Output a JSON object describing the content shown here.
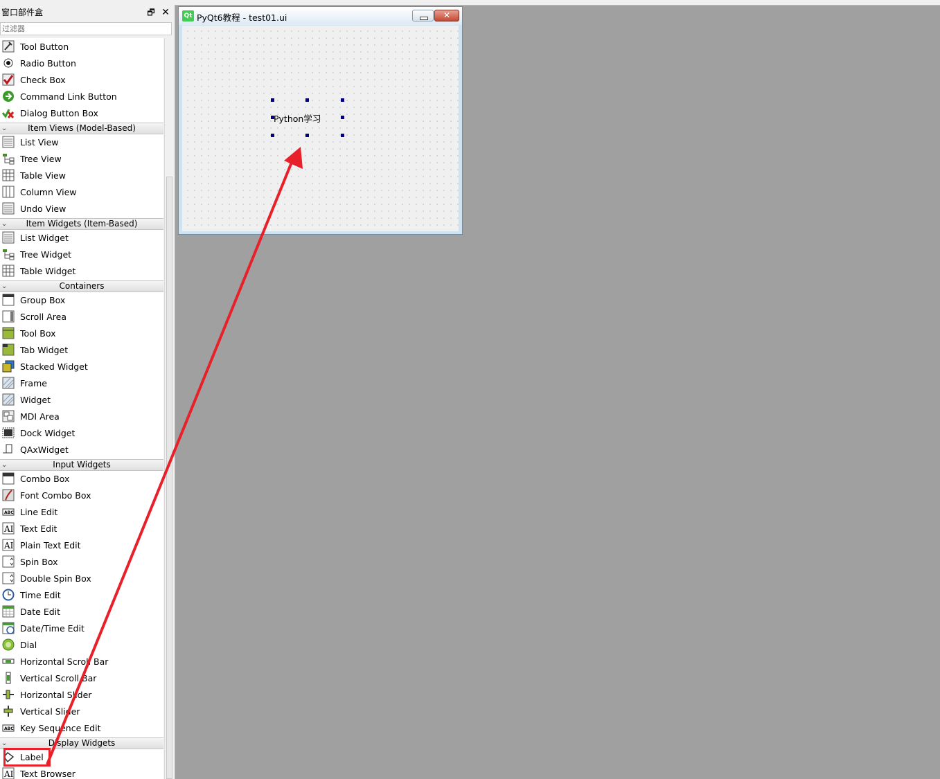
{
  "panel": {
    "title": "窗口部件盒",
    "float_glyph": "🗗",
    "close_glyph": "✕",
    "filter_placeholder": "过滤器"
  },
  "widget_list": [
    {
      "kind": "item",
      "label": "Tool Button",
      "icon": "tool-button-icon"
    },
    {
      "kind": "item",
      "label": "Radio Button",
      "icon": "radio-button-icon"
    },
    {
      "kind": "item",
      "label": "Check Box",
      "icon": "check-box-icon"
    },
    {
      "kind": "item",
      "label": "Command Link Button",
      "icon": "command-link-icon"
    },
    {
      "kind": "item",
      "label": "Dialog Button Box",
      "icon": "dialog-button-box-icon"
    },
    {
      "kind": "cat",
      "label": "Item Views (Model-Based)"
    },
    {
      "kind": "item",
      "label": "List View",
      "icon": "list-view-icon"
    },
    {
      "kind": "item",
      "label": "Tree View",
      "icon": "tree-view-icon"
    },
    {
      "kind": "item",
      "label": "Table View",
      "icon": "table-view-icon"
    },
    {
      "kind": "item",
      "label": "Column View",
      "icon": "column-view-icon"
    },
    {
      "kind": "item",
      "label": "Undo View",
      "icon": "undo-view-icon"
    },
    {
      "kind": "cat",
      "label": "Item Widgets (Item-Based)"
    },
    {
      "kind": "item",
      "label": "List Widget",
      "icon": "list-widget-icon"
    },
    {
      "kind": "item",
      "label": "Tree Widget",
      "icon": "tree-widget-icon"
    },
    {
      "kind": "item",
      "label": "Table Widget",
      "icon": "table-widget-icon"
    },
    {
      "kind": "cat",
      "label": "Containers"
    },
    {
      "kind": "item",
      "label": "Group Box",
      "icon": "group-box-icon"
    },
    {
      "kind": "item",
      "label": "Scroll Area",
      "icon": "scroll-area-icon"
    },
    {
      "kind": "item",
      "label": "Tool Box",
      "icon": "tool-box-icon"
    },
    {
      "kind": "item",
      "label": "Tab Widget",
      "icon": "tab-widget-icon"
    },
    {
      "kind": "item",
      "label": "Stacked Widget",
      "icon": "stacked-widget-icon"
    },
    {
      "kind": "item",
      "label": "Frame",
      "icon": "frame-icon"
    },
    {
      "kind": "item",
      "label": "Widget",
      "icon": "widget-icon"
    },
    {
      "kind": "item",
      "label": "MDI Area",
      "icon": "mdi-area-icon"
    },
    {
      "kind": "item",
      "label": "Dock Widget",
      "icon": "dock-widget-icon"
    },
    {
      "kind": "item",
      "label": "QAxWidget",
      "icon": "qaxwidget-icon"
    },
    {
      "kind": "cat",
      "label": "Input Widgets"
    },
    {
      "kind": "item",
      "label": "Combo Box",
      "icon": "combo-box-icon"
    },
    {
      "kind": "item",
      "label": "Font Combo Box",
      "icon": "font-combo-box-icon"
    },
    {
      "kind": "item",
      "label": "Line Edit",
      "icon": "line-edit-icon"
    },
    {
      "kind": "item",
      "label": "Text Edit",
      "icon": "text-edit-icon"
    },
    {
      "kind": "item",
      "label": "Plain Text Edit",
      "icon": "plain-text-edit-icon"
    },
    {
      "kind": "item",
      "label": "Spin Box",
      "icon": "spin-box-icon"
    },
    {
      "kind": "item",
      "label": "Double Spin Box",
      "icon": "double-spin-box-icon"
    },
    {
      "kind": "item",
      "label": "Time Edit",
      "icon": "time-edit-icon"
    },
    {
      "kind": "item",
      "label": "Date Edit",
      "icon": "date-edit-icon"
    },
    {
      "kind": "item",
      "label": "Date/Time Edit",
      "icon": "date-time-edit-icon"
    },
    {
      "kind": "item",
      "label": "Dial",
      "icon": "dial-icon"
    },
    {
      "kind": "item",
      "label": "Horizontal Scroll Bar",
      "icon": "horizontal-scroll-bar-icon"
    },
    {
      "kind": "item",
      "label": "Vertical Scroll Bar",
      "icon": "vertical-scroll-bar-icon"
    },
    {
      "kind": "item",
      "label": "Horizontal Slider",
      "icon": "horizontal-slider-icon"
    },
    {
      "kind": "item",
      "label": "Vertical Slider",
      "icon": "vertical-slider-icon"
    },
    {
      "kind": "item",
      "label": "Key Sequence Edit",
      "icon": "key-sequence-edit-icon"
    },
    {
      "kind": "cat",
      "label": "Display Widgets"
    },
    {
      "kind": "item",
      "label": "Label",
      "icon": "label-icon"
    },
    {
      "kind": "item",
      "label": "Text Browser",
      "icon": "text-browser-icon"
    }
  ],
  "form_window": {
    "logo_text": "Qt",
    "title": "PyQt6教程 - test01.ui",
    "close_glyph": "✕",
    "label_text": "Python学习"
  },
  "colors": {
    "annotation_red": "#e8202a",
    "handle_blue": "#000080",
    "qt_green": "#41cd52"
  }
}
